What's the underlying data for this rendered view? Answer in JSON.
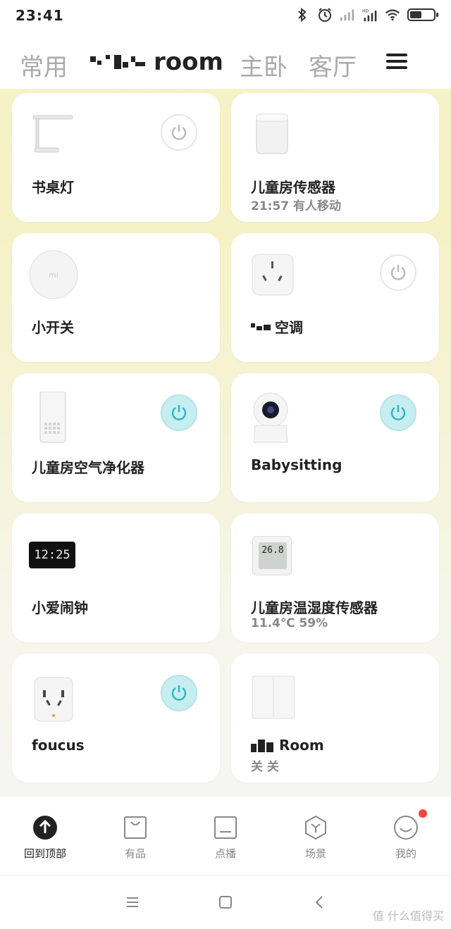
{
  "status_bar": {
    "time": "23:41",
    "icons": [
      "bluetooth-icon",
      "alarm-icon",
      "signal-icon",
      "hd-signal-icon",
      "wifi-icon",
      "battery-icon"
    ]
  },
  "tabs": [
    {
      "label": "常用",
      "active": false
    },
    {
      "label": "room",
      "active": true
    },
    {
      "label": "主卧",
      "active": false
    },
    {
      "label": "客厅",
      "active": false
    }
  ],
  "devices": [
    {
      "name": "书桌灯",
      "status": "",
      "icon": "desk-lamp-icon",
      "power": "off"
    },
    {
      "name": "儿童房传感器",
      "status": "21:57 有人移动",
      "icon": "motion-sensor-icon",
      "power": null
    },
    {
      "name": "小开关",
      "status": "",
      "icon": "wireless-switch-icon",
      "power": null
    },
    {
      "name": "空调",
      "status": "",
      "icon": "smart-plug-icon",
      "power": "off"
    },
    {
      "name": "儿童房空气净化器",
      "status": "",
      "icon": "air-purifier-icon",
      "power": "on"
    },
    {
      "name": "Babysitting",
      "status": "",
      "icon": "camera-icon",
      "power": "on"
    },
    {
      "name": "小爱闹钟",
      "status": "",
      "icon": "alarm-clock-icon",
      "power": null,
      "display": "12:25"
    },
    {
      "name": "儿童房温湿度传感器",
      "status": "11.4℃ 59%",
      "icon": "thermometer-icon",
      "power": null,
      "display": "26.8"
    },
    {
      "name": "foucus",
      "status": "",
      "icon": "power-strip-icon",
      "power": "on"
    },
    {
      "name": "Room",
      "status": "关 关",
      "icon": "wall-switch-icon",
      "power": null
    }
  ],
  "bottom_nav": [
    {
      "label": "回到顶部",
      "icon": "back-to-top-icon",
      "active": true
    },
    {
      "label": "有品",
      "icon": "shopping-bag-icon",
      "active": false
    },
    {
      "label": "点播",
      "icon": "vod-icon",
      "active": false
    },
    {
      "label": "场景",
      "icon": "scene-icon",
      "active": false
    },
    {
      "label": "我的",
      "icon": "profile-smile-icon",
      "active": false,
      "badge": true
    }
  ],
  "watermark": "值 什么值得买",
  "colors": {
    "power_on": "#c6eef0",
    "power_on_icon": "#2bb8c6",
    "power_off_icon": "#bbbbbb",
    "badge": "#f2453d"
  }
}
